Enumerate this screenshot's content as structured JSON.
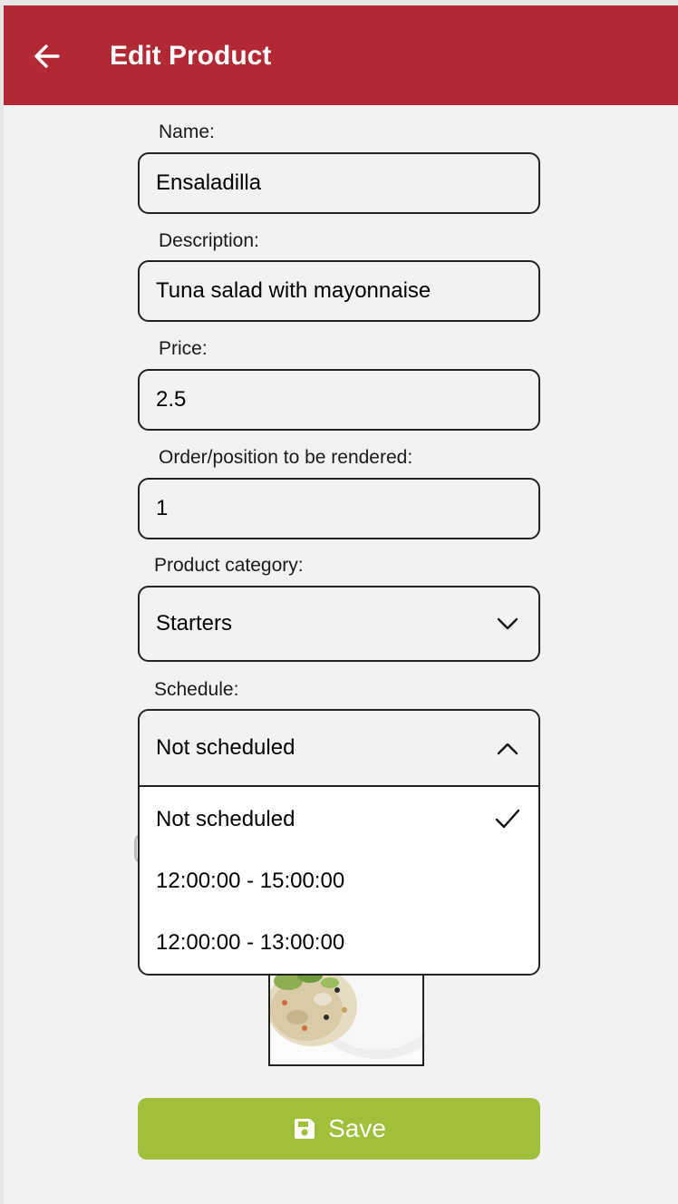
{
  "header": {
    "title": "Edit Product",
    "back_icon": "arrow-left-icon",
    "background_color": "#b22834"
  },
  "form": {
    "name": {
      "label": "Name:",
      "value": "Ensaladilla"
    },
    "description": {
      "label": "Description:",
      "value": "Tuna salad with mayonnaise"
    },
    "price": {
      "label": "Price:",
      "value": "2.5"
    },
    "order": {
      "label": "Order/position to be rendered:",
      "value": "1"
    },
    "category": {
      "label": "Product category:",
      "value": "Starters"
    },
    "schedule": {
      "label": "Schedule:",
      "value": "Not scheduled",
      "expanded": true,
      "options": [
        {
          "label": "Not scheduled",
          "selected": true
        },
        {
          "label": "12:00:00 - 15:00:00",
          "selected": false
        },
        {
          "label": "12:00:00 - 13:00:00",
          "selected": false
        }
      ]
    }
  },
  "save_button": {
    "label": "Save",
    "icon": "floppy-disk-icon",
    "color": "#a0c03b"
  }
}
